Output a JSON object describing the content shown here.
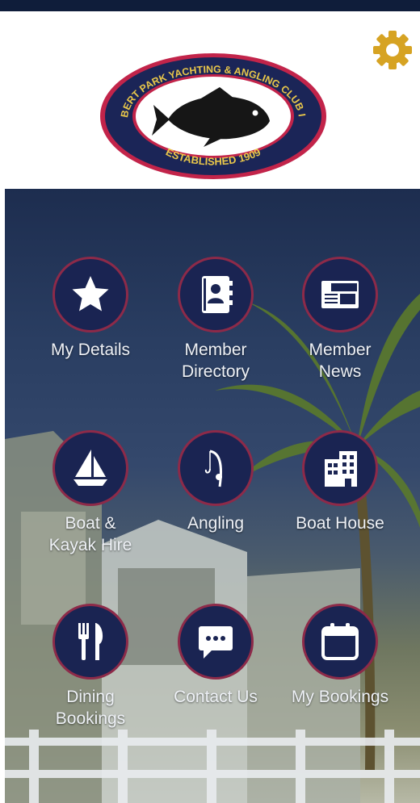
{
  "header": {
    "logo": {
      "ring_text": "ALBERT PARK YACHTING & ANGLING CLUB INC",
      "established": "ESTABLISHED 1909"
    },
    "settings_icon": "gear-icon"
  },
  "colors": {
    "navy": "#1a2452",
    "ring": "#8d2a49",
    "gold": "#d6a323"
  },
  "menu": [
    {
      "label": "My Details",
      "icon": "star-icon"
    },
    {
      "label": "Member\nDirectory",
      "icon": "address-book-icon"
    },
    {
      "label": "Member\nNews",
      "icon": "newspaper-icon"
    },
    {
      "label": "Boat &\nKayak Hire",
      "icon": "sailboat-icon"
    },
    {
      "label": "Angling",
      "icon": "fishing-rod-icon"
    },
    {
      "label": "Boat House",
      "icon": "building-icon"
    },
    {
      "label": "Dining\nBookings",
      "icon": "cutlery-icon"
    },
    {
      "label": "Contact Us",
      "icon": "chat-icon"
    },
    {
      "label": "My Bookings",
      "icon": "calendar-icon"
    }
  ]
}
